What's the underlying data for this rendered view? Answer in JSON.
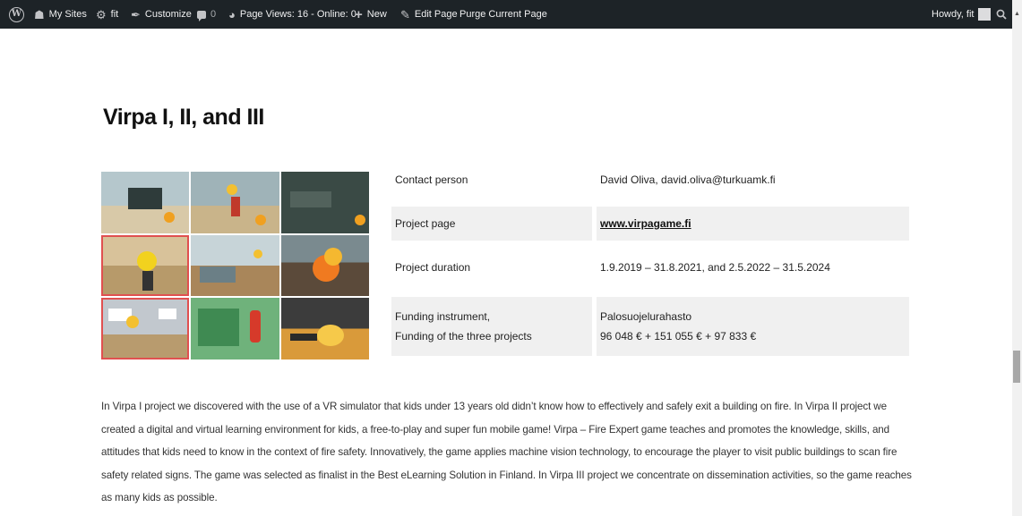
{
  "admin_bar": {
    "my_sites": "My Sites",
    "site_name": "fit",
    "customize": "Customize",
    "comments_count": "0",
    "stats": "Page Views: 16 - Online: 0",
    "new": "New",
    "edit_page": "Edit Page",
    "purge": "Purge Current Page",
    "howdy": "Howdy, fit"
  },
  "page": {
    "title": "Virpa I, II, and III"
  },
  "info_table": {
    "contact_label": "Contact person",
    "contact_value": "David Oliva, david.oliva@turkuamk.fi",
    "page_label": "Project page",
    "page_value": "www.virpagame.fi",
    "duration_label": "Project duration",
    "duration_value": "1.9.2019 – 31.8.2021, and 2.5.2022 – 31.5.2024",
    "funding_label_1": "Funding instrument,",
    "funding_label_2": "Funding of the three projects",
    "funding_value_1": "Palosuojelurahasto",
    "funding_value_2": "96 048 € + 151 055 € + 97 833 €"
  },
  "description": "In Virpa I project we discovered with the use of a VR simulator that kids under 13 years old didn’t know how to effectively and safely exit a building on fire. In Virpa II project we created a digital and virtual learning environment for kids, a free-to-play and super fun mobile game! Virpa – Fire Expert game teaches and promotes the knowledge, skills, and attitudes that kids need to know in the context of fire safety. Innovatively, the game applies machine vision technology, to encourage the player to visit public buildings to scan fire safety related signs. The game was selected as finalist in the Best eLearning Solution in Finland. In Virpa III project we concentrate on dissemination activities, so the game reaches as many kids as possible.",
  "icons": {
    "wordpress": "wordpress-logo",
    "sites": "my-sites-icon",
    "site": "site-icon",
    "customize": "brush-icon",
    "comments": "comment-icon",
    "stats": "stats-icon",
    "new": "plus-icon",
    "edit": "pencil-icon",
    "search": "search-icon"
  }
}
